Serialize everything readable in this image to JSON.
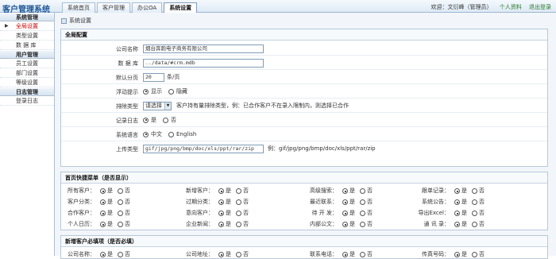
{
  "app": {
    "title": "客户管理系统"
  },
  "nav_tabs": [
    "系统首页",
    "客户管理",
    "办公OA",
    "系统设置"
  ],
  "user": {
    "welcome": "欢迎：文衍峰（管理员）",
    "profile_link": "个人资料",
    "logout_link": "退出登录"
  },
  "sidebar": {
    "sections": [
      {
        "title": "系统管理",
        "items": [
          "全局设置",
          "类型设置",
          "数 据 库"
        ]
      },
      {
        "title": "用户管理",
        "items": [
          "员工设置",
          "部门设置",
          "等级设置"
        ]
      },
      {
        "title": "日志管理",
        "items": [
          "登录日志"
        ]
      }
    ],
    "active_item": "全局设置"
  },
  "breadcrumb": "系统设置",
  "global": {
    "title": "全局配置",
    "company_label": "公司名称",
    "company_value": "烟台奔跑电子商务有限公司",
    "db_label": "数 据 库",
    "db_value": "../data/#crm.mdb",
    "page_label": "默认分页",
    "page_value": "20",
    "page_unit": "条/页",
    "float_label": "浮动提示",
    "float_show": "显示",
    "float_hide": "隐藏",
    "sort_label": "排除类型",
    "sort_select": "请选择",
    "sort_hint": "客户持有量排除类型，例：已合作客户不在录入限制内，则选择已合作",
    "log_label": "记录日志",
    "yes": "是",
    "no": "否",
    "lang_label": "系统语言",
    "lang_cn": "中文",
    "lang_en": "English",
    "upload_label": "上传类型",
    "upload_value": "gif/jpg/png/bmp/doc/xls/ppt/rar/zip",
    "upload_hint": "例：gif/jpg/png/bmp/doc/xls/ppt/rar/zip"
  },
  "quick": {
    "title": "首页快捷菜单（是否显示）",
    "rows": [
      [
        "所有客户：",
        "新增客户：",
        "高级搜索：",
        "跟单记录："
      ],
      [
        "客户分类：",
        "过期分类：",
        "最近联系：",
        "系统公告："
      ],
      [
        "合作客户：",
        "意向客户：",
        "待 开 发：",
        "导出Excel："
      ],
      [
        "个人日历：",
        "企业新闻：",
        "内部公文：",
        "通 讯 录："
      ]
    ]
  },
  "required": {
    "title": "新增客户必填项（是否必填）",
    "rows": [
      [
        "公司名称：",
        "公司地址：",
        "联系电话：",
        "传真号码："
      ]
    ]
  }
}
